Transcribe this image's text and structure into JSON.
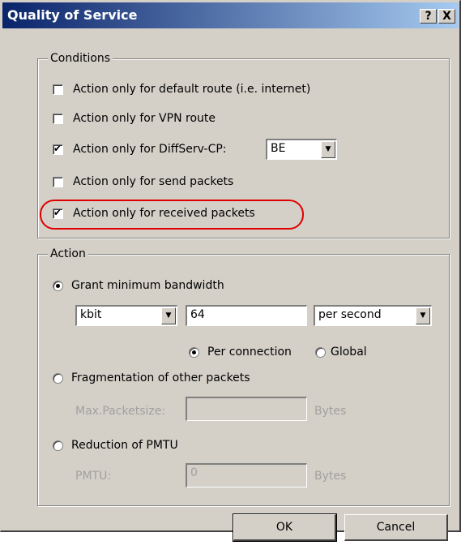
{
  "window": {
    "title": "Quality of Service",
    "help_button": "?",
    "close_button": "X"
  },
  "conditions": {
    "legend": "Conditions",
    "items": [
      {
        "label": "Action only for default route (i.e. internet)",
        "checked": false
      },
      {
        "label": "Action only for VPN route",
        "checked": false
      },
      {
        "label": "Action only for DiffServ-CP:",
        "checked": true
      },
      {
        "label": "Action only for send packets",
        "checked": false
      },
      {
        "label": "Action only for received packets",
        "checked": true
      }
    ],
    "diffserv_value": "BE"
  },
  "action": {
    "legend": "Action",
    "grant_label": "Grant minimum bandwidth",
    "unit_value": "kbit",
    "bandwidth_value": "64",
    "rate_value": "per second",
    "per_connection_label": "Per connection",
    "global_label": "Global",
    "fragmentation_label": "Fragmentation of other packets",
    "max_packetsize_label": "Max.Packetsize:",
    "max_packetsize_value": "",
    "bytes_label_1": "Bytes",
    "pmtu_reduction_label": "Reduction of PMTU",
    "pmtu_label": "PMTU:",
    "pmtu_value": "0",
    "bytes_label_2": "Bytes"
  },
  "buttons": {
    "ok": "OK",
    "cancel": "Cancel"
  },
  "colors": {
    "highlight": "#e00000",
    "titlebar_start": "#0a246a",
    "titlebar_end": "#a6caf0"
  }
}
